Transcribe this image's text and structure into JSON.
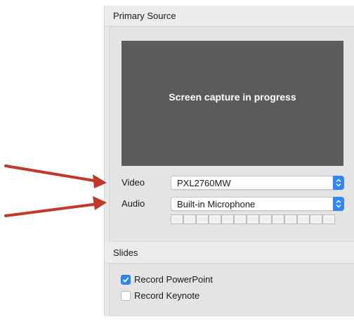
{
  "primary_source": {
    "title": "Primary Source",
    "preview_text": "Screen capture in progress",
    "video_label": "Video",
    "video_value": "PXL2760MW",
    "audio_label": "Audio",
    "audio_value": "Built-in Microphone",
    "audio_level_segments": 13
  },
  "slides": {
    "title": "Slides",
    "options": [
      {
        "label": "Record PowerPoint",
        "checked": true
      },
      {
        "label": "Record Keynote",
        "checked": false
      }
    ]
  },
  "colors": {
    "accent": "#2f86f4",
    "arrow": "#c0392b",
    "preview_bg": "#5b5b5b"
  },
  "icons": {
    "stepper": "up-down-chevron-icon",
    "check": "checkmark-icon",
    "annotation": "red-arrow-icon"
  }
}
